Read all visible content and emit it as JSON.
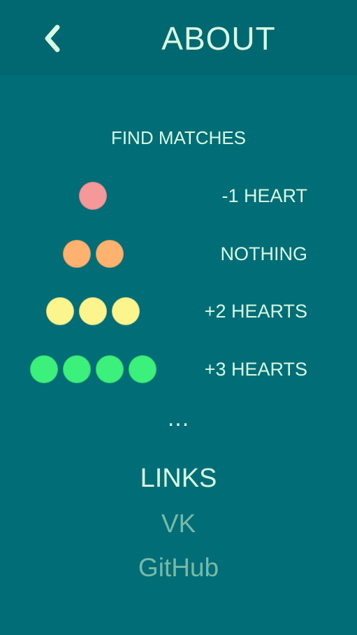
{
  "header": {
    "title": "ABOUT",
    "back_icon": "chevron-left-icon"
  },
  "rules": {
    "heading": "FIND MATCHES",
    "rows": [
      {
        "count": 1,
        "color": "#f59899",
        "reward": "-1 HEART"
      },
      {
        "count": 2,
        "color": "#fdb26f",
        "reward": "NOTHING"
      },
      {
        "count": 3,
        "color": "#fcf58d",
        "reward": "+2 HEARTS"
      },
      {
        "count": 4,
        "color": "#3cf07c",
        "reward": "+3 HEARTS"
      }
    ],
    "more": "..."
  },
  "links": {
    "heading": "LINKS",
    "items": [
      "VK",
      "GitHub"
    ]
  },
  "colors": {
    "background": "#016e77",
    "header_background": "#016770",
    "text": "#d8fbe2",
    "link": "#79b9a8"
  }
}
